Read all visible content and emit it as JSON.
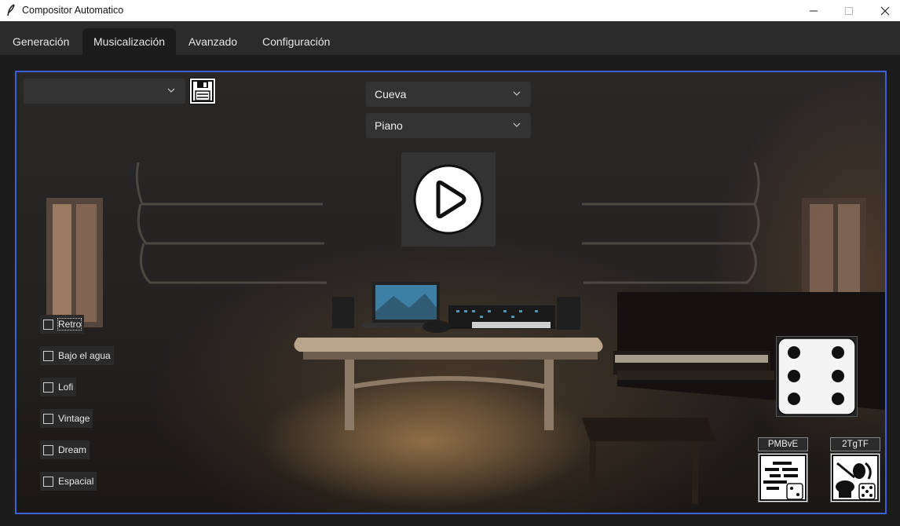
{
  "window": {
    "title": "Compositor Automatico"
  },
  "tabs": [
    {
      "label": "Generación",
      "active": false
    },
    {
      "label": "Musicalización",
      "active": true
    },
    {
      "label": "Avanzado",
      "active": false
    },
    {
      "label": "Configuración",
      "active": false
    }
  ],
  "preset_dropdown": {
    "value": ""
  },
  "scene_dropdown": {
    "value": "Cueva"
  },
  "instrument_dropdown": {
    "value": "Piano"
  },
  "effects": [
    {
      "label": "Retro",
      "checked": false,
      "focused": true
    },
    {
      "label": "Bajo el agua",
      "checked": false
    },
    {
      "label": "Lofi",
      "checked": false
    },
    {
      "label": "Vintage",
      "checked": false
    },
    {
      "label": "Dream",
      "checked": false
    },
    {
      "label": "Espacial",
      "checked": false
    }
  ],
  "tools": [
    {
      "label": "PMBvE",
      "icon": "random-melody-icon"
    },
    {
      "label": "2TgTF",
      "icon": "random-instruments-icon"
    }
  ],
  "icons": [
    "feather-icon",
    "save-icon",
    "play-icon",
    "dice-icon",
    "chevron-down-icon"
  ],
  "colors": {
    "frame_border": "#3a62d6",
    "background": "#1c1c1c",
    "tab_bar": "#2b2b2b"
  }
}
